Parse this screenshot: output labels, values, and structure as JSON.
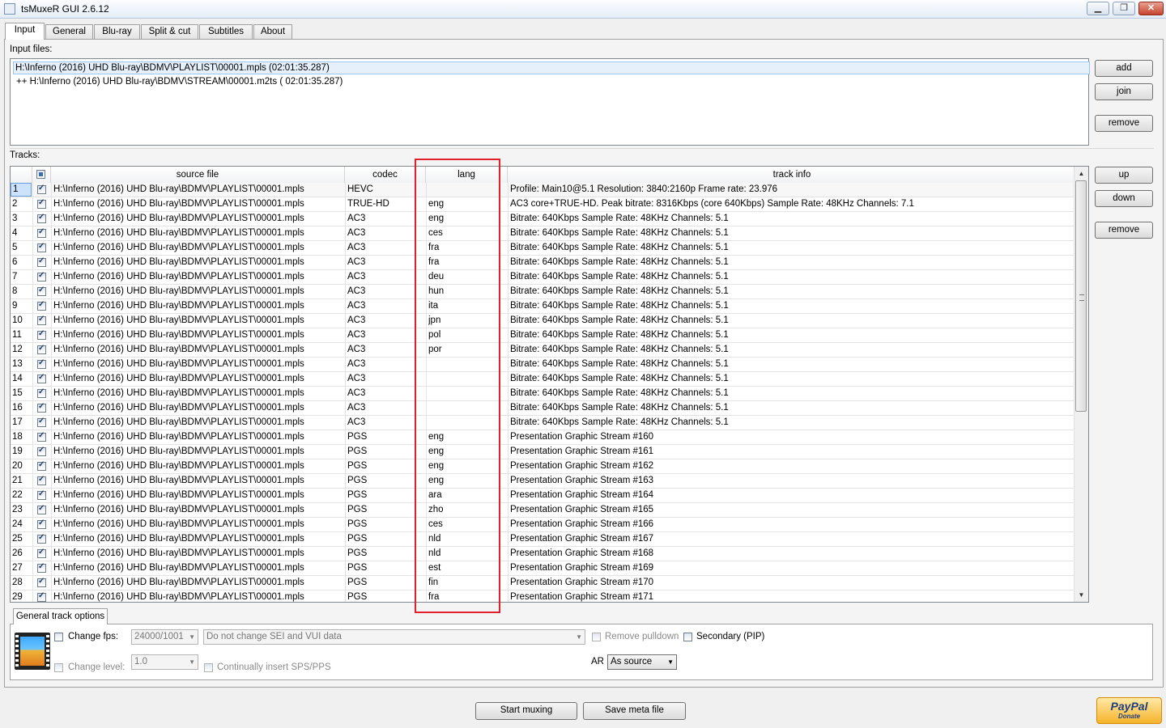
{
  "window": {
    "title": "tsMuxeR GUI 2.6.12",
    "minimize": "▁",
    "maximize": "❐",
    "close": "✕"
  },
  "tabs": [
    "Input",
    "General",
    "Blu-ray",
    "Split & cut",
    "Subtitles",
    "About"
  ],
  "input": {
    "label": "Input files:",
    "files": [
      "H:\\Inferno (2016) UHD Blu-ray\\BDMV\\PLAYLIST\\00001.mpls (02:01:35.287)",
      "++ H:\\Inferno (2016) UHD Blu-ray\\BDMV\\STREAM\\00001.m2ts ( 02:01:35.287)"
    ],
    "buttons": {
      "add": "add",
      "join": "join",
      "remove": "remove"
    }
  },
  "tracks": {
    "label": "Tracks:",
    "columns": {
      "source": "source file",
      "codec": "codec",
      "lang": "lang",
      "info": "track info"
    },
    "buttons": {
      "up": "up",
      "down": "down",
      "remove": "remove"
    },
    "rows": [
      {
        "n": "1",
        "src": "H:\\Inferno (2016) UHD Blu-ray\\BDMV\\PLAYLIST\\00001.mpls",
        "codec": "HEVC",
        "lang": "",
        "info": "Profile: Main10@5.1 Resolution: 3840:2160p Frame rate: 23.976"
      },
      {
        "n": "2",
        "src": "H:\\Inferno (2016) UHD Blu-ray\\BDMV\\PLAYLIST\\00001.mpls",
        "codec": "TRUE-HD",
        "lang": "eng",
        "info": "AC3 core+TRUE-HD. Peak bitrate: 8316Kbps (core 640Kbps) Sample Rate: 48KHz Channels: 7.1"
      },
      {
        "n": "3",
        "src": "H:\\Inferno (2016) UHD Blu-ray\\BDMV\\PLAYLIST\\00001.mpls",
        "codec": "AC3",
        "lang": "eng",
        "info": "Bitrate: 640Kbps Sample Rate: 48KHz Channels: 5.1"
      },
      {
        "n": "4",
        "src": "H:\\Inferno (2016) UHD Blu-ray\\BDMV\\PLAYLIST\\00001.mpls",
        "codec": "AC3",
        "lang": "ces",
        "info": "Bitrate: 640Kbps Sample Rate: 48KHz Channels: 5.1"
      },
      {
        "n": "5",
        "src": "H:\\Inferno (2016) UHD Blu-ray\\BDMV\\PLAYLIST\\00001.mpls",
        "codec": "AC3",
        "lang": "fra",
        "info": "Bitrate: 640Kbps Sample Rate: 48KHz Channels: 5.1"
      },
      {
        "n": "6",
        "src": "H:\\Inferno (2016) UHD Blu-ray\\BDMV\\PLAYLIST\\00001.mpls",
        "codec": "AC3",
        "lang": "fra",
        "info": "Bitrate: 640Kbps Sample Rate: 48KHz Channels: 5.1"
      },
      {
        "n": "7",
        "src": "H:\\Inferno (2016) UHD Blu-ray\\BDMV\\PLAYLIST\\00001.mpls",
        "codec": "AC3",
        "lang": "deu",
        "info": "Bitrate: 640Kbps Sample Rate: 48KHz Channels: 5.1"
      },
      {
        "n": "8",
        "src": "H:\\Inferno (2016) UHD Blu-ray\\BDMV\\PLAYLIST\\00001.mpls",
        "codec": "AC3",
        "lang": "hun",
        "info": "Bitrate: 640Kbps Sample Rate: 48KHz Channels: 5.1"
      },
      {
        "n": "9",
        "src": "H:\\Inferno (2016) UHD Blu-ray\\BDMV\\PLAYLIST\\00001.mpls",
        "codec": "AC3",
        "lang": "ita",
        "info": "Bitrate: 640Kbps Sample Rate: 48KHz Channels: 5.1"
      },
      {
        "n": "10",
        "src": "H:\\Inferno (2016) UHD Blu-ray\\BDMV\\PLAYLIST\\00001.mpls",
        "codec": "AC3",
        "lang": "jpn",
        "info": "Bitrate: 640Kbps Sample Rate: 48KHz Channels: 5.1"
      },
      {
        "n": "11",
        "src": "H:\\Inferno (2016) UHD Blu-ray\\BDMV\\PLAYLIST\\00001.mpls",
        "codec": "AC3",
        "lang": "pol",
        "info": "Bitrate: 640Kbps Sample Rate: 48KHz Channels: 5.1"
      },
      {
        "n": "12",
        "src": "H:\\Inferno (2016) UHD Blu-ray\\BDMV\\PLAYLIST\\00001.mpls",
        "codec": "AC3",
        "lang": "por",
        "info": "Bitrate: 640Kbps Sample Rate: 48KHz Channels: 5.1"
      },
      {
        "n": "13",
        "src": "H:\\Inferno (2016) UHD Blu-ray\\BDMV\\PLAYLIST\\00001.mpls",
        "codec": "AC3",
        "lang": "",
        "info": "Bitrate: 640Kbps Sample Rate: 48KHz Channels: 5.1"
      },
      {
        "n": "14",
        "src": "H:\\Inferno (2016) UHD Blu-ray\\BDMV\\PLAYLIST\\00001.mpls",
        "codec": "AC3",
        "lang": "",
        "info": "Bitrate: 640Kbps Sample Rate: 48KHz Channels: 5.1"
      },
      {
        "n": "15",
        "src": "H:\\Inferno (2016) UHD Blu-ray\\BDMV\\PLAYLIST\\00001.mpls",
        "codec": "AC3",
        "lang": "",
        "info": "Bitrate: 640Kbps Sample Rate: 48KHz Channels: 5.1"
      },
      {
        "n": "16",
        "src": "H:\\Inferno (2016) UHD Blu-ray\\BDMV\\PLAYLIST\\00001.mpls",
        "codec": "AC3",
        "lang": "",
        "info": "Bitrate: 640Kbps Sample Rate: 48KHz Channels: 5.1"
      },
      {
        "n": "17",
        "src": "H:\\Inferno (2016) UHD Blu-ray\\BDMV\\PLAYLIST\\00001.mpls",
        "codec": "AC3",
        "lang": "",
        "info": "Bitrate: 640Kbps Sample Rate: 48KHz Channels: 5.1"
      },
      {
        "n": "18",
        "src": "H:\\Inferno (2016) UHD Blu-ray\\BDMV\\PLAYLIST\\00001.mpls",
        "codec": "PGS",
        "lang": "eng",
        "info": "Presentation Graphic Stream #160"
      },
      {
        "n": "19",
        "src": "H:\\Inferno (2016) UHD Blu-ray\\BDMV\\PLAYLIST\\00001.mpls",
        "codec": "PGS",
        "lang": "eng",
        "info": "Presentation Graphic Stream #161"
      },
      {
        "n": "20",
        "src": "H:\\Inferno (2016) UHD Blu-ray\\BDMV\\PLAYLIST\\00001.mpls",
        "codec": "PGS",
        "lang": "eng",
        "info": "Presentation Graphic Stream #162"
      },
      {
        "n": "21",
        "src": "H:\\Inferno (2016) UHD Blu-ray\\BDMV\\PLAYLIST\\00001.mpls",
        "codec": "PGS",
        "lang": "eng",
        "info": "Presentation Graphic Stream #163"
      },
      {
        "n": "22",
        "src": "H:\\Inferno (2016) UHD Blu-ray\\BDMV\\PLAYLIST\\00001.mpls",
        "codec": "PGS",
        "lang": "ara",
        "info": "Presentation Graphic Stream #164"
      },
      {
        "n": "23",
        "src": "H:\\Inferno (2016) UHD Blu-ray\\BDMV\\PLAYLIST\\00001.mpls",
        "codec": "PGS",
        "lang": "zho",
        "info": "Presentation Graphic Stream #165"
      },
      {
        "n": "24",
        "src": "H:\\Inferno (2016) UHD Blu-ray\\BDMV\\PLAYLIST\\00001.mpls",
        "codec": "PGS",
        "lang": "ces",
        "info": "Presentation Graphic Stream #166"
      },
      {
        "n": "25",
        "src": "H:\\Inferno (2016) UHD Blu-ray\\BDMV\\PLAYLIST\\00001.mpls",
        "codec": "PGS",
        "lang": "nld",
        "info": "Presentation Graphic Stream #167"
      },
      {
        "n": "26",
        "src": "H:\\Inferno (2016) UHD Blu-ray\\BDMV\\PLAYLIST\\00001.mpls",
        "codec": "PGS",
        "lang": "nld",
        "info": "Presentation Graphic Stream #168"
      },
      {
        "n": "27",
        "src": "H:\\Inferno (2016) UHD Blu-ray\\BDMV\\PLAYLIST\\00001.mpls",
        "codec": "PGS",
        "lang": "est",
        "info": "Presentation Graphic Stream #169"
      },
      {
        "n": "28",
        "src": "H:\\Inferno (2016) UHD Blu-ray\\BDMV\\PLAYLIST\\00001.mpls",
        "codec": "PGS",
        "lang": "fin",
        "info": "Presentation Graphic Stream #170"
      },
      {
        "n": "29",
        "src": "H:\\Inferno (2016) UHD Blu-ray\\BDMV\\PLAYLIST\\00001.mpls",
        "codec": "PGS",
        "lang": "fra",
        "info": "Presentation Graphic Stream #171"
      }
    ]
  },
  "options": {
    "tab": "General track options",
    "change_fps": "Change fps:",
    "fps_value": "24000/1001",
    "sei_value": "Do not change SEI and VUI data",
    "remove_pulldown": "Remove pulldown",
    "secondary": "Secondary (PIP)",
    "change_level": "Change level:",
    "level_value": "1.0",
    "insert_sps": "Continually insert SPS/PPS",
    "ar_label": "AR",
    "ar_value": "As source"
  },
  "footer": {
    "start": "Start muxing",
    "meta": "Save meta file",
    "paypal": "PayPal",
    "donate": "Donate"
  },
  "colors": {
    "highlight": "#e0202a",
    "selection": "#cde2fb"
  }
}
